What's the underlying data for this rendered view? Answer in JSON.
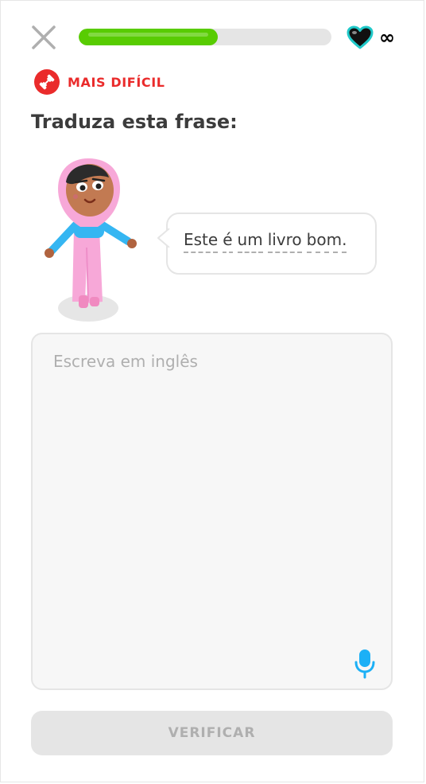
{
  "header": {
    "progress_percent": 55,
    "hearts_count": "∞"
  },
  "challenge": {
    "badge_label": "MAIS DIFÍCIL",
    "instruction": "Traduza esta frase:",
    "sentence_words": [
      "Este",
      "é",
      "um",
      "livro",
      "bom."
    ]
  },
  "answer": {
    "placeholder": "Escreva em inglês",
    "value": ""
  },
  "footer": {
    "check_label": "VERIFICAR"
  },
  "colors": {
    "progress": "#58cc02",
    "hard_badge": "#ea2b2b",
    "heart_outline": "#20c9c9",
    "mic": "#1cb0f6",
    "disabled_button": "#e5e5e5"
  },
  "icons": {
    "close": "close-icon",
    "heart": "heart-icon",
    "hard": "dumbbell-icon",
    "mic": "microphone-icon"
  }
}
